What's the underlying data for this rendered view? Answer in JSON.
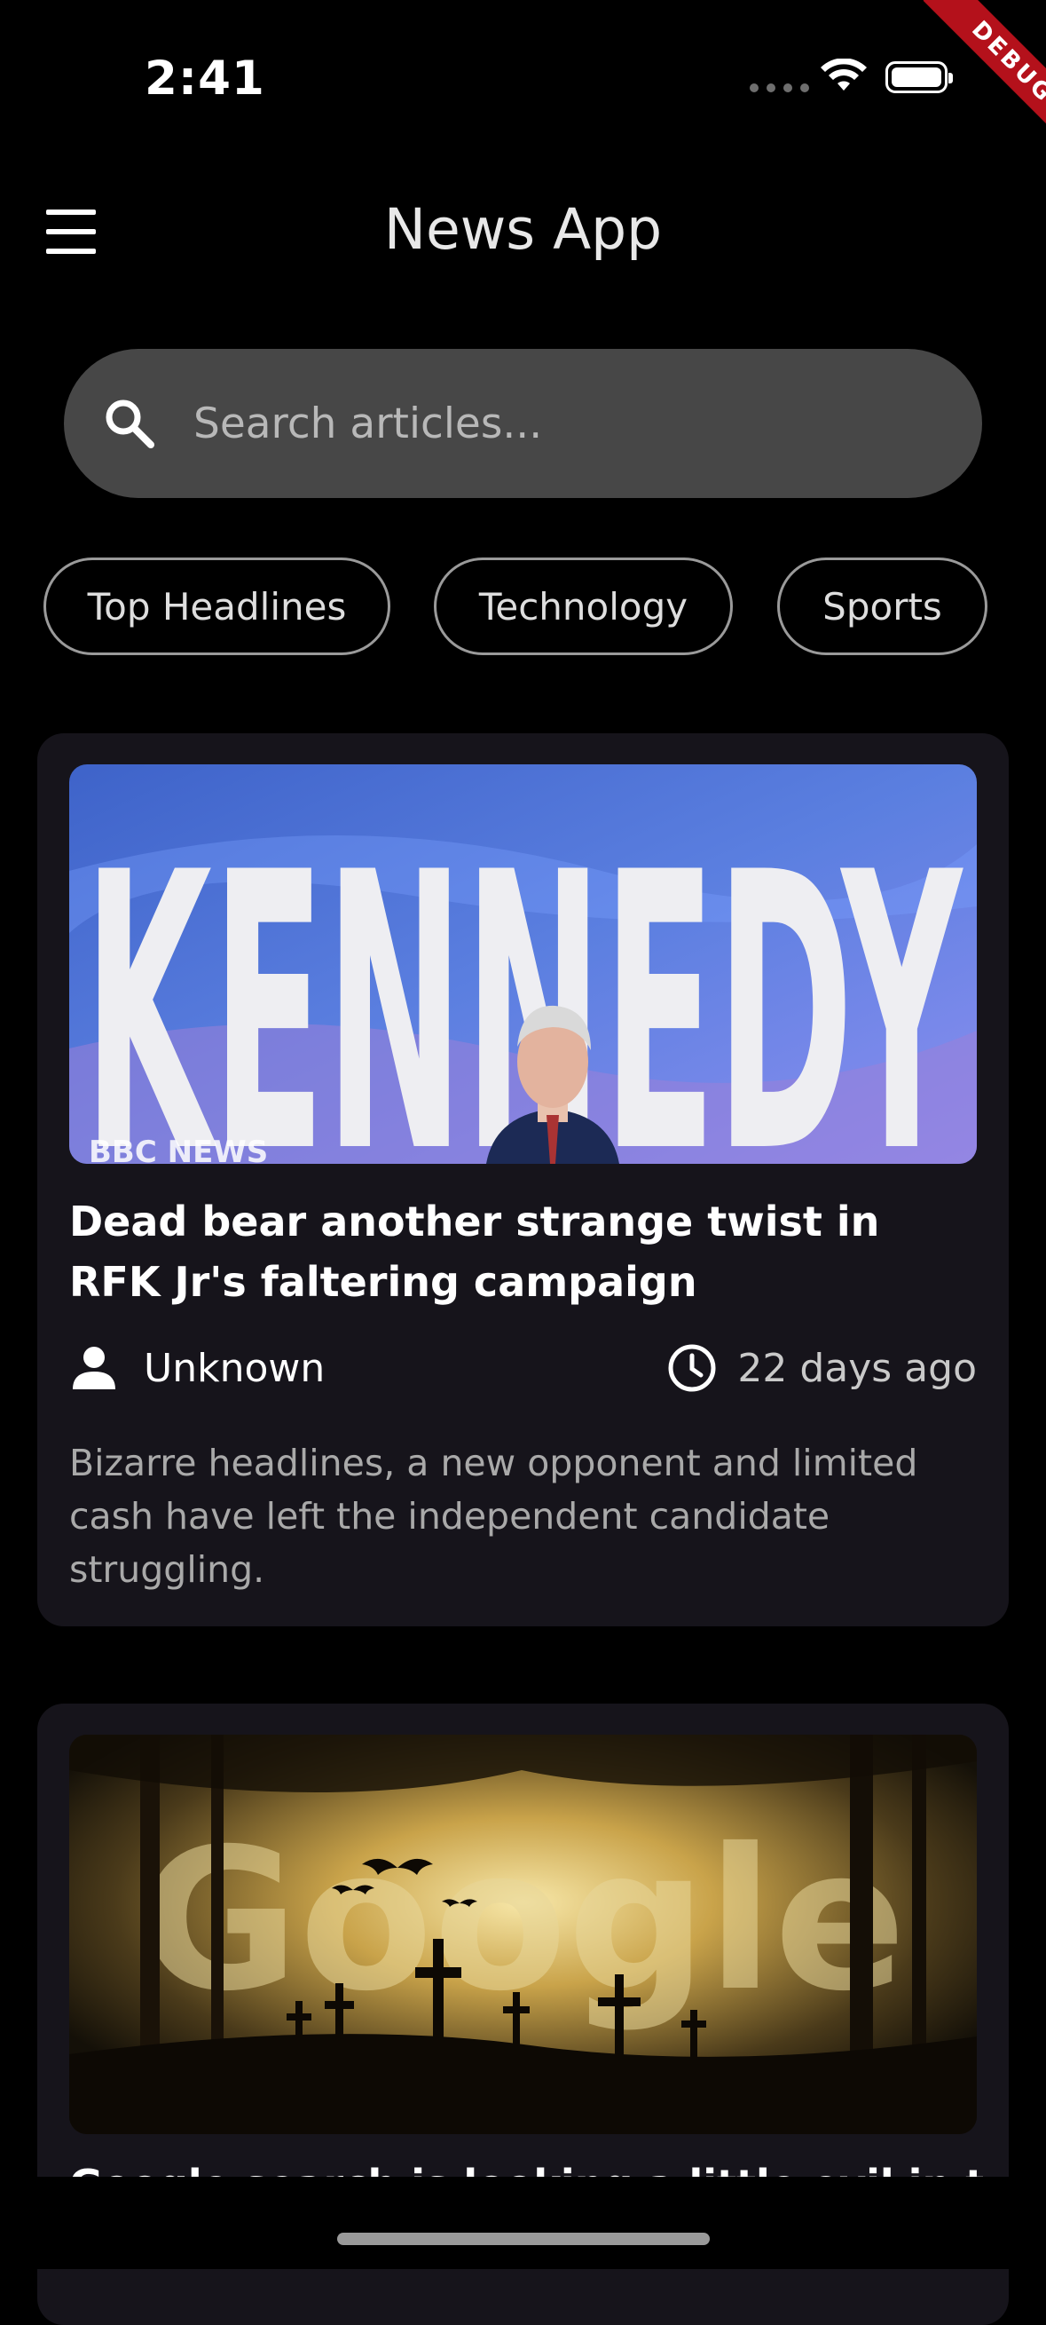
{
  "status_bar": {
    "time": "2:41"
  },
  "debug_label": "DEBUG",
  "app_bar": {
    "title": "News App"
  },
  "search": {
    "placeholder": "Search articles..."
  },
  "categories": [
    "Top Headlines",
    "Technology",
    "Sports"
  ],
  "articles": [
    {
      "image_text": "KENNEDY",
      "image_watermark": "BBC NEWS",
      "title": "Dead bear another strange twist in RFK Jr's faltering campaign",
      "author": "Unknown",
      "time": "22 days ago",
      "description": "Bizarre headlines, a new opponent and limited cash have left the independent candidate struggling."
    },
    {
      "image_text": "Google",
      "title": "Google search is looking a little evil in this"
    }
  ],
  "colors": {
    "background": "#000000",
    "card": "#16141b",
    "search_bg": "#474747",
    "debug_ribbon": "#b4111b"
  }
}
